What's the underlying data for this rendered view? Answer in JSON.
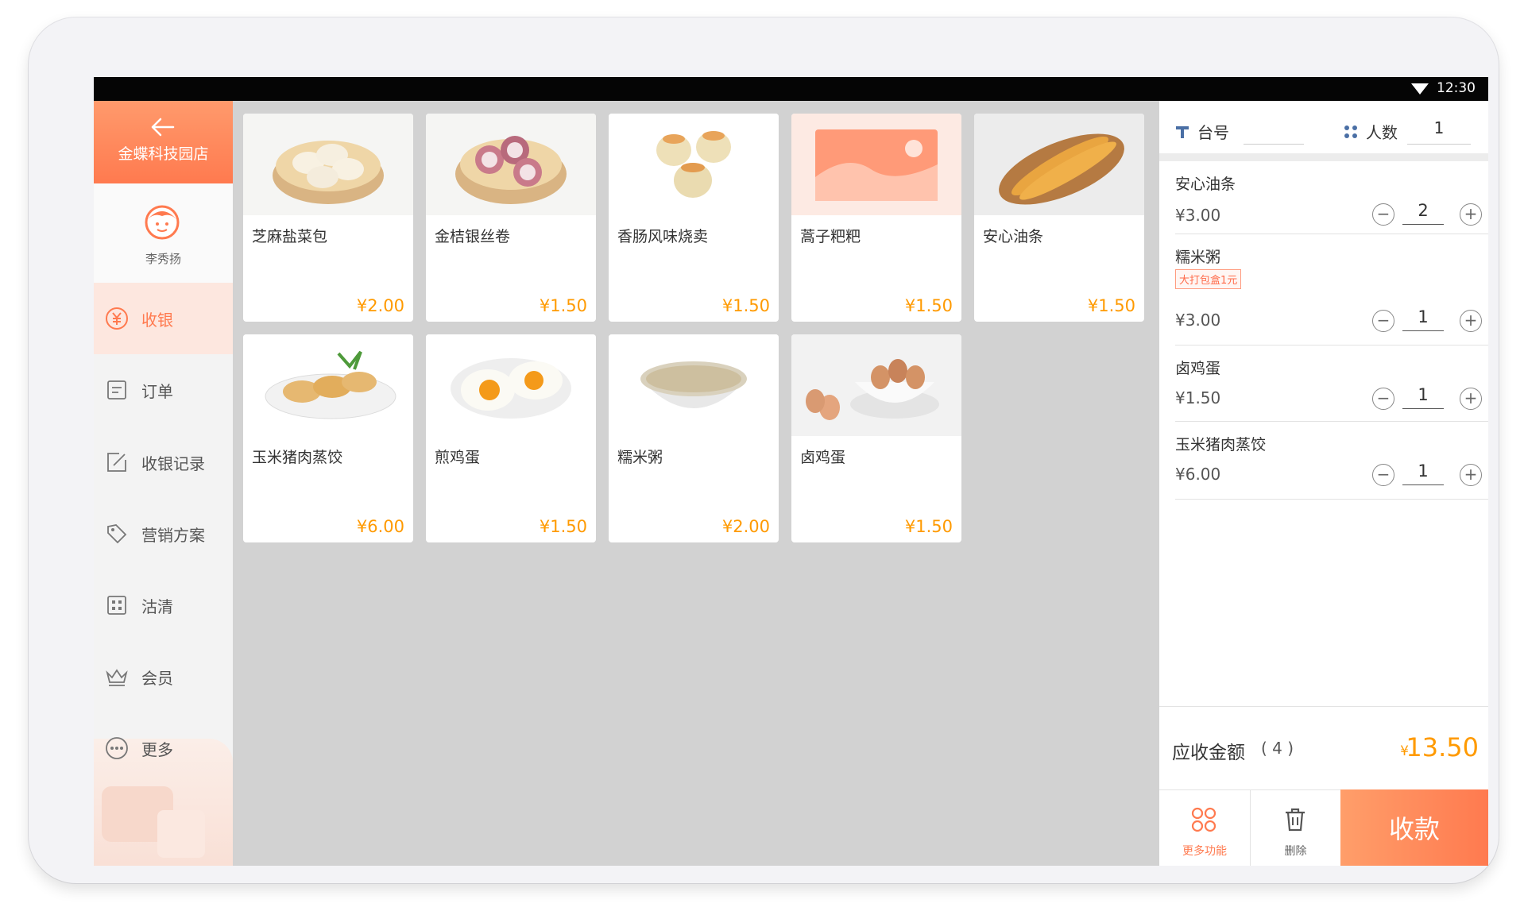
{
  "status_bar": {
    "time": "12:30",
    "wifi_icon": "wifi-icon"
  },
  "sidebar": {
    "store_name": "金蝶科技园店",
    "user_name": "李秀扬",
    "items": [
      {
        "label": "收银",
        "icon": "cashier-icon",
        "active": true
      },
      {
        "label": "订单",
        "icon": "order-icon",
        "active": false
      },
      {
        "label": "收银记录",
        "icon": "record-icon",
        "active": false
      },
      {
        "label": "营销方案",
        "icon": "tag-icon",
        "active": false
      },
      {
        "label": "沽清",
        "icon": "grid-icon",
        "active": false
      },
      {
        "label": "会员",
        "icon": "crown-icon",
        "active": false
      },
      {
        "label": "更多",
        "icon": "more-icon",
        "active": false
      }
    ]
  },
  "products": [
    {
      "name": "芝麻盐菜包",
      "price": "¥2.00",
      "image": "steamed-buns"
    },
    {
      "name": "金桔银丝卷",
      "price": "¥1.50",
      "image": "silver-rolls"
    },
    {
      "name": "香肠风味烧卖",
      "price": "¥1.50",
      "image": "shaomai"
    },
    {
      "name": "蒿子粑粑",
      "price": "¥1.50",
      "image": "placeholder"
    },
    {
      "name": "安心油条",
      "price": "¥1.50",
      "image": "fried-dough"
    },
    {
      "name": "玉米猪肉蒸饺",
      "price": "¥6.00",
      "image": "dumplings"
    },
    {
      "name": "煎鸡蛋",
      "price": "¥1.50",
      "image": "fried-eggs"
    },
    {
      "name": "糯米粥",
      "price": "¥2.00",
      "image": "porridge"
    },
    {
      "name": "卤鸡蛋",
      "price": "¥1.50",
      "image": "eggs"
    }
  ],
  "order_panel": {
    "table_label": "台号",
    "table_value": "",
    "people_label": "人数",
    "people_value": "1",
    "items": [
      {
        "name": "安心油条",
        "tag": "",
        "price": "¥3.00",
        "qty": "2"
      },
      {
        "name": "糯米粥",
        "tag": "大打包盒1元",
        "price": "¥3.00",
        "qty": "1"
      },
      {
        "name": "卤鸡蛋",
        "tag": "",
        "price": "¥1.50",
        "qty": "1"
      },
      {
        "name": "玉米猪肉蒸饺",
        "tag": "",
        "price": "¥6.00",
        "qty": "1"
      }
    ],
    "minus": "−",
    "plus": "+",
    "total_label": "应收金额",
    "total_count": "( 4 )",
    "total_currency": "¥",
    "total_amount": "13.50",
    "more_label": "更多功能",
    "delete_label": "删除",
    "pay_label": "收款"
  },
  "colors": {
    "accent": "#ff7a4f",
    "price": "#ff9a00",
    "active_bg": "#fde7df"
  }
}
